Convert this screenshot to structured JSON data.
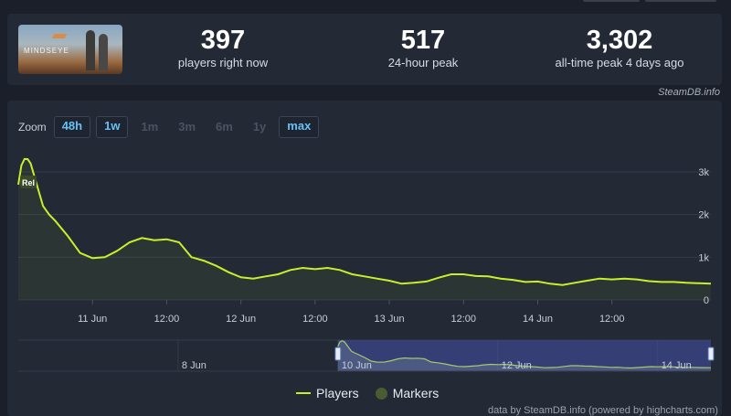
{
  "stats": {
    "game_title": "MINDSEYE",
    "players_now": {
      "value": "397",
      "label": "players right now"
    },
    "peak_24h": {
      "value": "517",
      "label": "24-hour peak"
    },
    "all_time": {
      "value": "3,302",
      "label": "all-time peak 4 days ago"
    }
  },
  "credit_top": "SteamDB.info",
  "zoom": {
    "label": "Zoom",
    "buttons": [
      {
        "label": "48h",
        "active": true
      },
      {
        "label": "1w",
        "active": true
      },
      {
        "label": "1m",
        "active": false
      },
      {
        "label": "3m",
        "active": false
      },
      {
        "label": "6m",
        "active": false
      },
      {
        "label": "1y",
        "active": false
      },
      {
        "label": "max",
        "active": true
      }
    ]
  },
  "chart_data": {
    "type": "area",
    "flag_label": "Rel",
    "x_labels": [
      "11 Jun",
      "12:00",
      "12 Jun",
      "12:00",
      "13 Jun",
      "12:00",
      "14 Jun",
      "12:00"
    ],
    "y_ticks": [
      "0",
      "1k",
      "2k",
      "3k"
    ],
    "ylim": [
      0,
      3000
    ],
    "series": [
      {
        "name": "Players",
        "color": "#c7f02b",
        "x_hours": [
          0,
          0.5,
          1,
          1.5,
          2,
          3,
          4,
          5,
          6,
          8,
          10,
          12,
          14,
          16,
          18,
          20,
          22,
          24,
          26,
          28,
          30,
          32,
          34,
          36,
          38,
          40,
          42,
          44,
          46,
          48,
          50,
          52,
          54,
          56,
          58,
          60,
          62,
          64,
          66,
          68,
          70,
          72,
          74,
          76,
          78,
          80,
          82,
          84,
          86,
          88,
          90,
          92,
          94,
          96,
          98,
          100,
          102,
          104,
          106,
          108,
          110,
          112
        ],
        "values": [
          2700,
          3150,
          3302,
          3300,
          3200,
          2700,
          2200,
          2000,
          1850,
          1500,
          1100,
          980,
          1000,
          1150,
          1350,
          1450,
          1400,
          1420,
          1350,
          1000,
          920,
          800,
          650,
          530,
          500,
          550,
          600,
          700,
          750,
          720,
          750,
          700,
          600,
          550,
          500,
          450,
          380,
          400,
          430,
          520,
          600,
          600,
          560,
          550,
          500,
          470,
          420,
          430,
          380,
          350,
          400,
          450,
          500,
          480,
          500,
          480,
          440,
          420,
          420,
          400,
          390,
          380
        ]
      }
    ]
  },
  "navigator": {
    "labels": [
      "8 Jun",
      "10 Jun",
      "12 Jun",
      "14 Jun"
    ]
  },
  "legend": {
    "players": "Players",
    "markers": "Markers"
  },
  "credit_bottom": "data by SteamDB.info (powered by highcharts.com)"
}
